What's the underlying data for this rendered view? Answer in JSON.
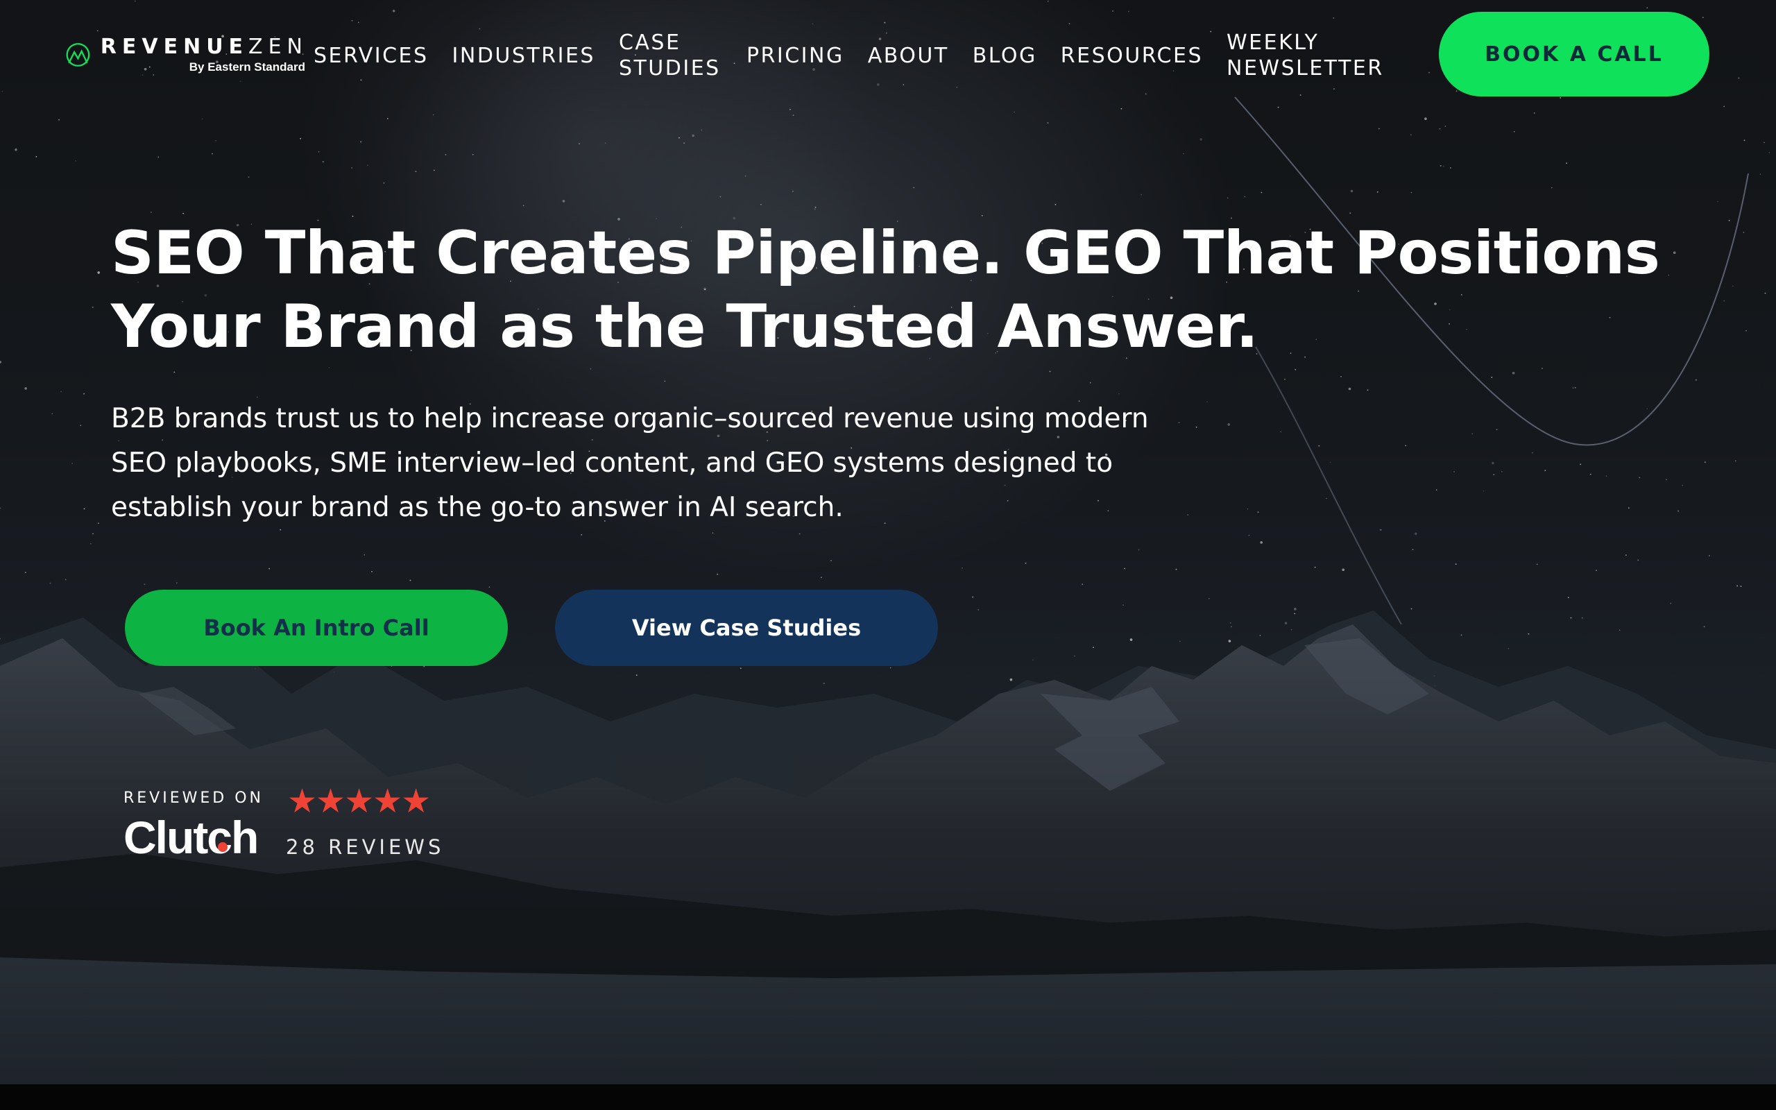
{
  "brand": {
    "name_bold": "REVENUE",
    "name_light": "ZEN",
    "tagline": "By Eastern Standard",
    "logo_icon": "mountain-circle-icon",
    "accent_color": "#0fe15a"
  },
  "nav": {
    "items": [
      {
        "label": "SERVICES"
      },
      {
        "label": "INDUSTRIES"
      },
      {
        "label": "CASE STUDIES"
      },
      {
        "label": "PRICING"
      },
      {
        "label": "ABOUT"
      },
      {
        "label": "BLOG"
      },
      {
        "label": "RESOURCES"
      },
      {
        "label": "WEEKLY NEWSLETTER"
      }
    ],
    "cta_label": "BOOK A CALL"
  },
  "hero": {
    "headline": "SEO That Creates Pipeline. GEO That Positions Your Brand as the Trusted Answer.",
    "subtext": "B2B brands trust us to help increase organic–sourced revenue using modern SEO playbooks, SME interview–led content, and GEO systems designed to establish your brand as the go-to answer in AI search.",
    "primary_button": "Book An Intro Call",
    "secondary_button": "View Case Studies",
    "primary_color": "#0db443",
    "secondary_color": "#13335a"
  },
  "reviews": {
    "reviewed_on": "REVIEWED ON",
    "platform": "Clutch",
    "rating": 5,
    "count_label": "28 REVIEWS",
    "star_color": "#ef4335"
  }
}
